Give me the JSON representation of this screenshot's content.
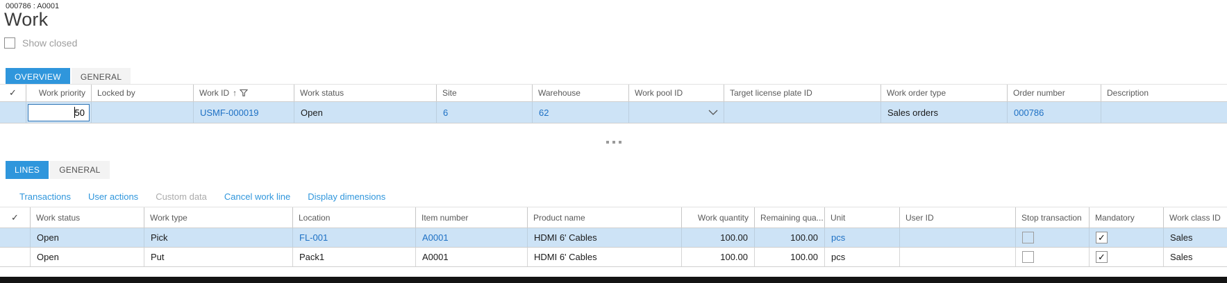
{
  "window": {
    "breadcrumb": "000786 : A0001",
    "title": "Work",
    "show_closed": {
      "label": "Show closed",
      "checked": false
    }
  },
  "header_tabs": [
    {
      "label": "OVERVIEW",
      "active": true
    },
    {
      "label": "GENERAL",
      "active": false
    }
  ],
  "work_grid": {
    "columns": [
      "",
      "Work priority",
      "Locked by",
      "Work ID",
      "Work status",
      "Site",
      "Warehouse",
      "Work pool ID",
      "Target license plate ID",
      "Work order type",
      "Order number",
      "Description"
    ],
    "sorted_column": "Work ID",
    "sort_direction": "ascending",
    "row": {
      "work_priority": "50",
      "locked_by": "",
      "work_id": "USMF-000019",
      "work_status": "Open",
      "site": "6",
      "warehouse": "62",
      "work_pool_id": "",
      "target_license_plate_id": "",
      "work_order_type": "Sales orders",
      "order_number": "000786",
      "description": ""
    }
  },
  "lines_tabs": [
    {
      "label": "LINES",
      "active": true
    },
    {
      "label": "GENERAL",
      "active": false
    }
  ],
  "line_actions": [
    {
      "label": "Transactions",
      "enabled": true
    },
    {
      "label": "User actions",
      "enabled": true
    },
    {
      "label": "Custom data",
      "enabled": false
    },
    {
      "label": "Cancel work line",
      "enabled": true
    },
    {
      "label": "Display dimensions",
      "enabled": true
    }
  ],
  "lines_grid": {
    "columns": [
      "",
      "Work status",
      "Work type",
      "Location",
      "Item number",
      "Product name",
      "Work quantity",
      "Remaining qua...",
      "Unit",
      "User ID",
      "Stop transaction",
      "Mandatory",
      "Work class ID"
    ],
    "rows": [
      {
        "work_status": "Open",
        "work_type": "Pick",
        "location": "FL-001",
        "item_number": "A0001",
        "product_name": "HDMI 6' Cables",
        "work_quantity": "100.00",
        "remaining_quantity": "100.00",
        "unit": "pcs",
        "user_id": "",
        "stop_transaction": false,
        "mandatory": true,
        "work_class_id": "Sales",
        "selected": true
      },
      {
        "work_status": "Open",
        "work_type": "Put",
        "location": "Pack1",
        "item_number": "A0001",
        "product_name": "HDMI 6' Cables",
        "work_quantity": "100.00",
        "remaining_quantity": "100.00",
        "unit": "pcs",
        "user_id": "",
        "stop_transaction": false,
        "mandatory": true,
        "work_class_id": "Sales",
        "selected": false
      }
    ]
  },
  "icons": {
    "header_select": "checkmark-icon",
    "sort": "sort-ascending-icon",
    "filter": "filter-icon",
    "work_pool_combo": "chevron-down-icon",
    "more_rows": "more-rows-ellipsis-icon"
  },
  "colors": {
    "accent": "#2f96dc",
    "link": "#1d70c4",
    "selected_row": "#cde3f6",
    "disabled_text": "#ababab"
  }
}
